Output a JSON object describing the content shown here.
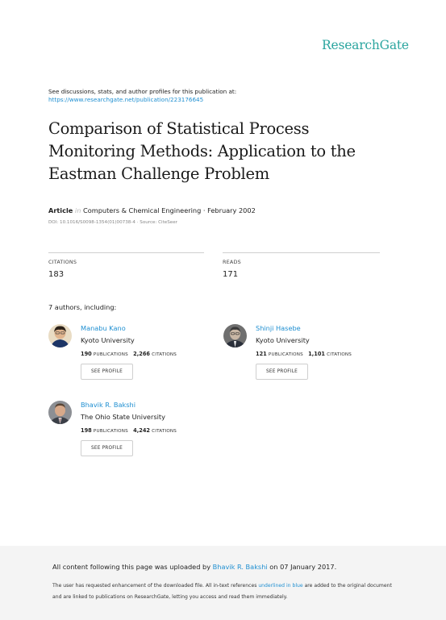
{
  "brand": "ResearchGate",
  "intro": {
    "text": "See discussions, stats, and author profiles for this publication at:",
    "link": "https://www.researchgate.net/publication/223176645"
  },
  "title_lines": [
    "Comparison of Statistical Process",
    "Monitoring Methods: Application to the",
    "Eastman Challenge Problem"
  ],
  "article": {
    "kind": "Article",
    "in_word": "in",
    "venue": "Computers & Chemical Engineering · February 2002",
    "doi": "DOI: 10.1016/S0098-1354(01)00738-4 · Source: CiteSeer"
  },
  "stats": {
    "citations_label": "CITATIONS",
    "citations_value": "183",
    "reads_label": "READS",
    "reads_value": "171"
  },
  "authors_heading": "7 authors, including:",
  "publications_label": "PUBLICATIONS",
  "citations_label": "CITATIONS",
  "profile_button": "SEE PROFILE",
  "authors": [
    {
      "name": "Manabu Kano",
      "institution": "Kyoto University",
      "publications": "190",
      "citations": "2,266"
    },
    {
      "name": "Shinji Hasebe",
      "institution": "Kyoto University",
      "publications": "121",
      "citations": "1,101"
    },
    {
      "name": "Bhavik R. Bakshi",
      "institution": "The Ohio State University",
      "publications": "198",
      "citations": "4,242"
    }
  ],
  "footer": {
    "upload_prefix": "All content following this page was uploaded by",
    "upload_user": "Bhavik R. Bakshi",
    "upload_suffix": "on 07 January 2017.",
    "note_prefix": "The user has requested enhancement of the downloaded file. All in-text references",
    "note_link": "underlined in blue",
    "note_suffix": "are added to the original document",
    "note_line2": "and are linked to publications on ResearchGate, letting you access and read them immediately."
  }
}
